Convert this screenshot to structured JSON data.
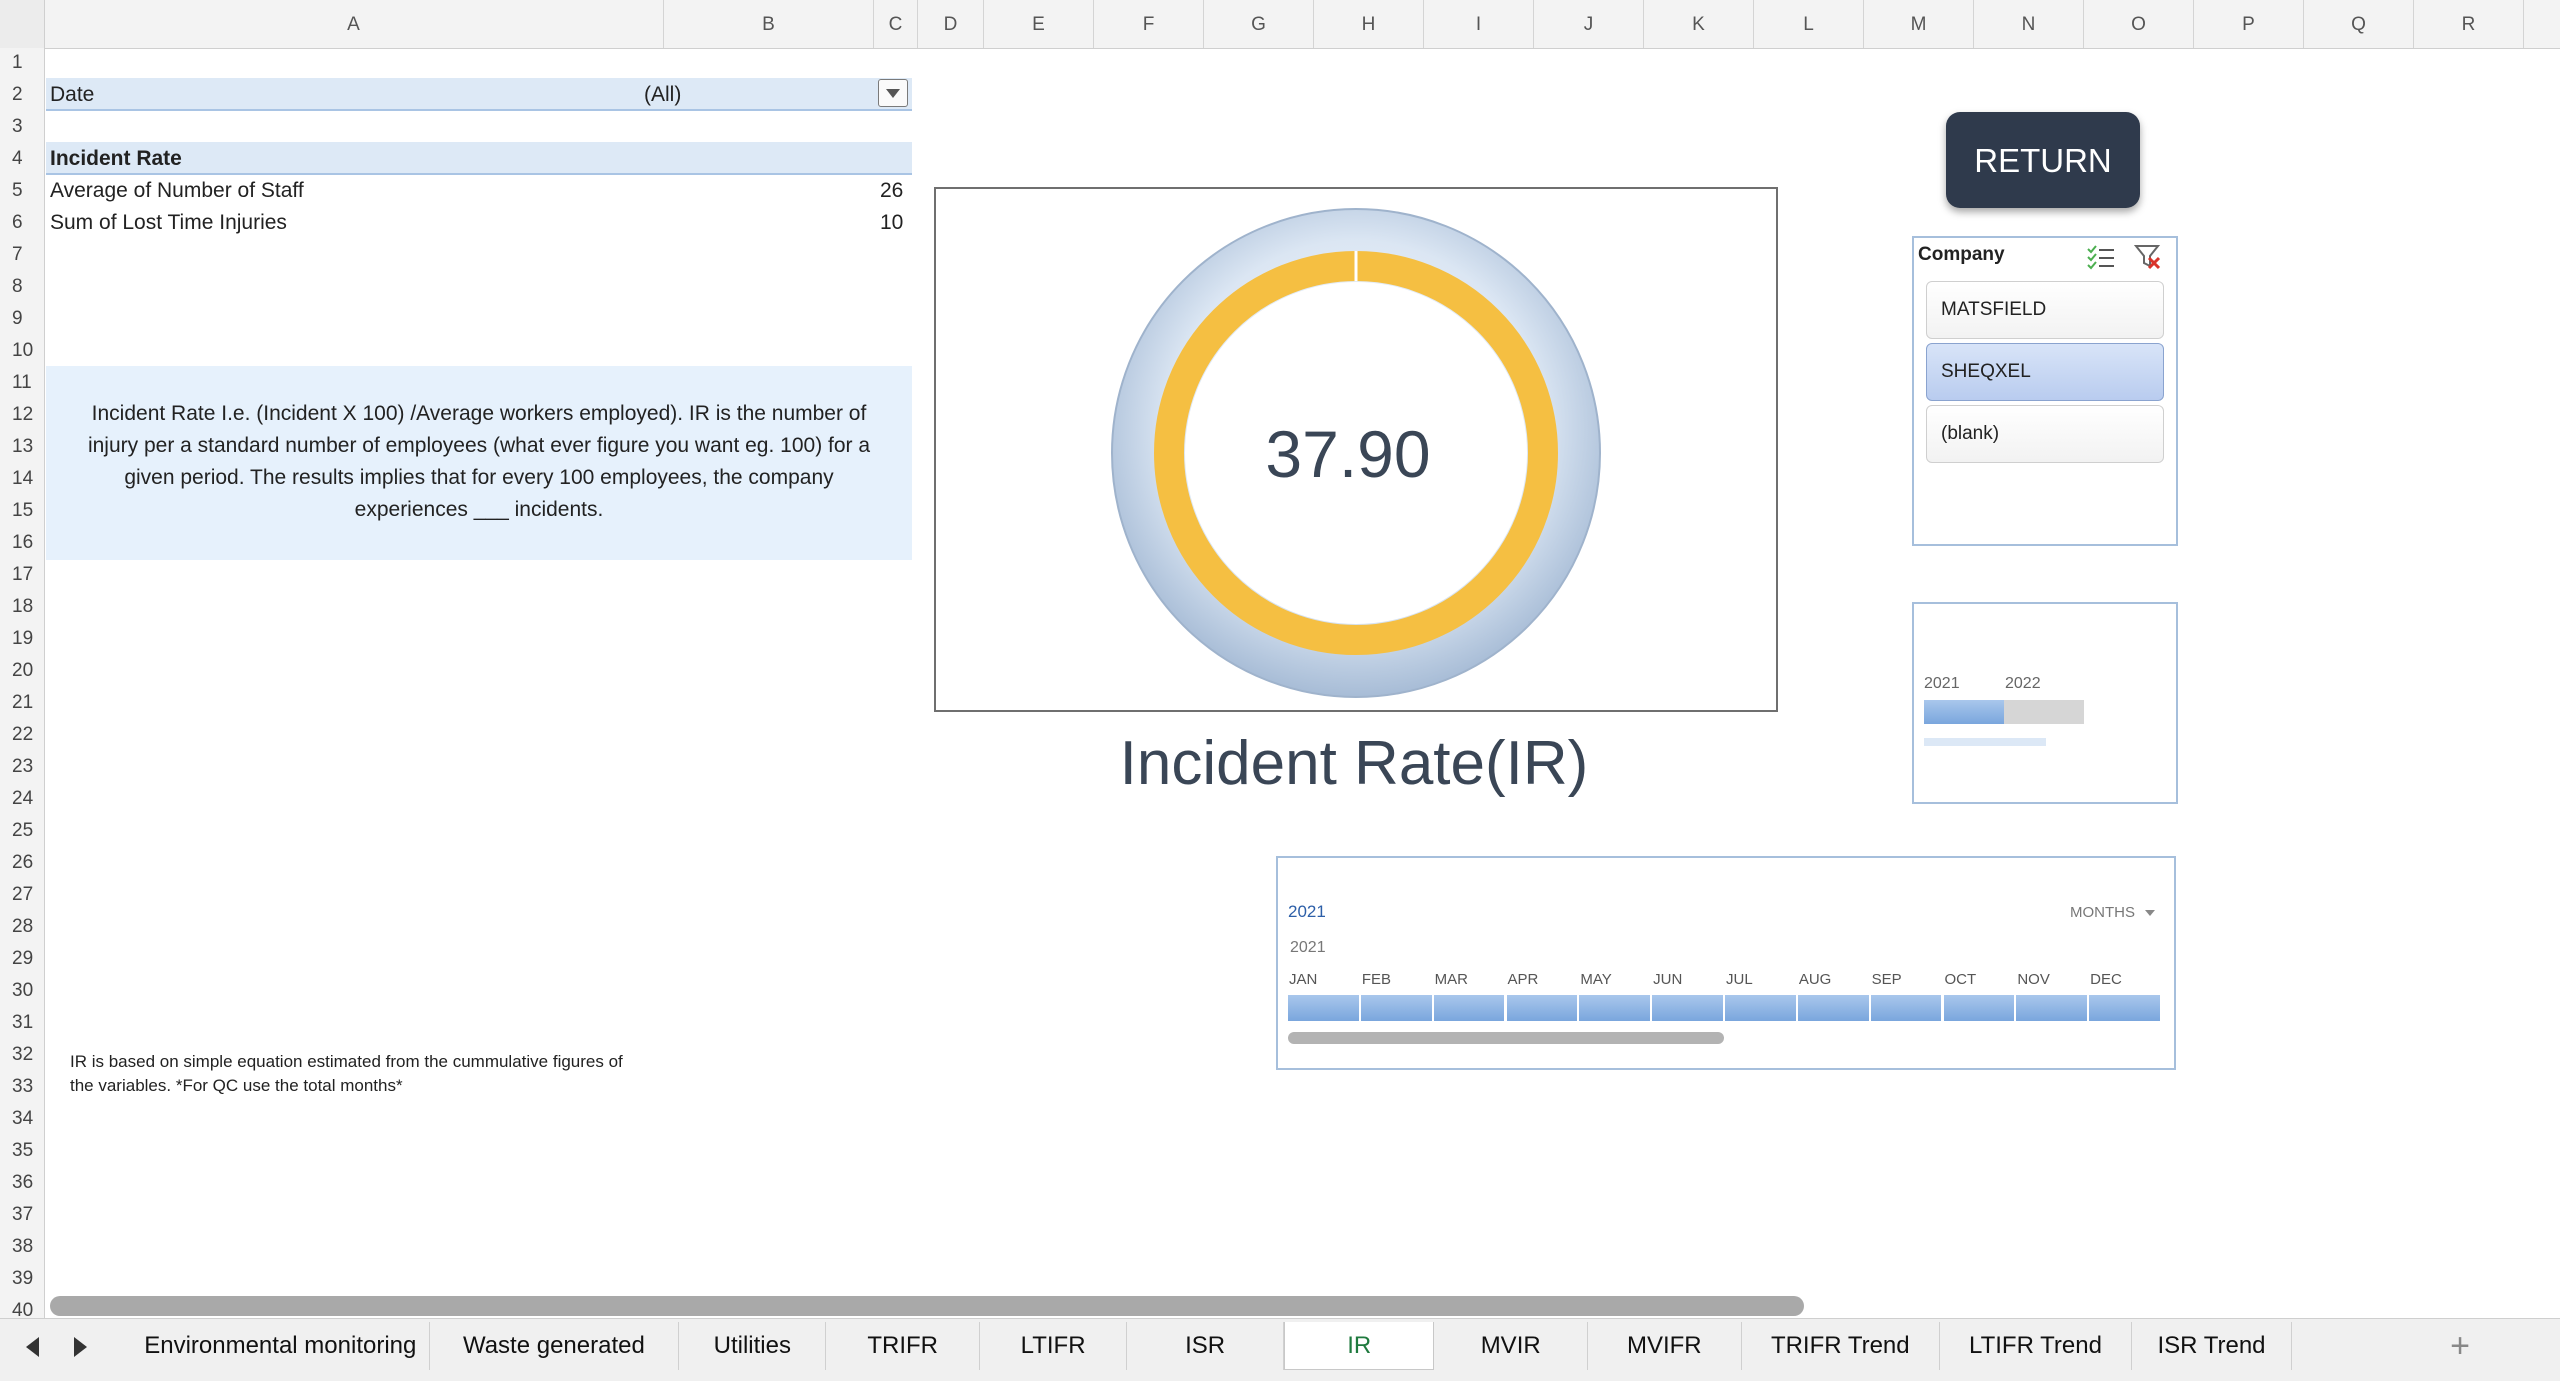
{
  "columns": [
    "A",
    "B",
    "C",
    "D",
    "E",
    "F",
    "G",
    "H",
    "I",
    "J",
    "K",
    "L",
    "M",
    "N",
    "O",
    "P",
    "Q",
    "R"
  ],
  "rows": [
    "1",
    "2",
    "3",
    "4",
    "5",
    "6",
    "7",
    "8",
    "9",
    "10",
    "11",
    "12",
    "13",
    "14",
    "15",
    "16",
    "17",
    "18",
    "19",
    "20",
    "21",
    "22",
    "23",
    "24",
    "25",
    "26",
    "27",
    "28",
    "29",
    "30",
    "31",
    "32",
    "33",
    "34",
    "35",
    "36",
    "37",
    "38",
    "39",
    "40"
  ],
  "pivot": {
    "filter_label": "Date",
    "filter_value": "(All)",
    "header": "Incident Rate",
    "row1_label": "Average of Number of Staff",
    "row1_value": "26",
    "row2_label": "Sum of Lost Time Injuries",
    "row2_value": "10"
  },
  "description": "Incident Rate I.e. (Incident X 100) /Average workers employed). IR is the number of\ninjury per a standard number of employees (what ever figure you want eg. 100) for a\ngiven period. The results implies that for every 100 employees, the company\nexperiences ___ incidents.",
  "note": "IR is based on simple equation estimated from the cummulative figures of\nthe variables. *For QC use the total months*",
  "gauge": {
    "value_text": "37.90",
    "title": "Incident Rate(IR)",
    "ring_color": "#f5bf42",
    "bezel_color": "#c5d6ea"
  },
  "return_label": "RETURN",
  "company_slicer": {
    "title": "Company",
    "items": [
      {
        "label": "MATSFIELD",
        "selected": false
      },
      {
        "label": "SHEQXEL",
        "selected": true
      },
      {
        "label": "(blank)",
        "selected": false
      }
    ]
  },
  "year_slicer": {
    "years": [
      "2021",
      "2022"
    ],
    "selected_fraction": 0.5
  },
  "timeline": {
    "period": "2021",
    "level": "MONTHS",
    "year": "2021",
    "months": [
      "JAN",
      "FEB",
      "MAR",
      "APR",
      "MAY",
      "JUN",
      "JUL",
      "AUG",
      "SEP",
      "OCT",
      "NOV",
      "DEC"
    ]
  },
  "tabs": [
    "Environmental monitoring",
    "Waste generated",
    "Utilities",
    "TRIFR",
    "LTIFR",
    "ISR",
    "IR",
    "MVIR",
    "MVIFR",
    "TRIFR Trend",
    "LTIFR Trend",
    "ISR Trend"
  ],
  "active_tab": "IR",
  "add_sheet_label": "+",
  "accent_color": "#1f7a3e"
}
